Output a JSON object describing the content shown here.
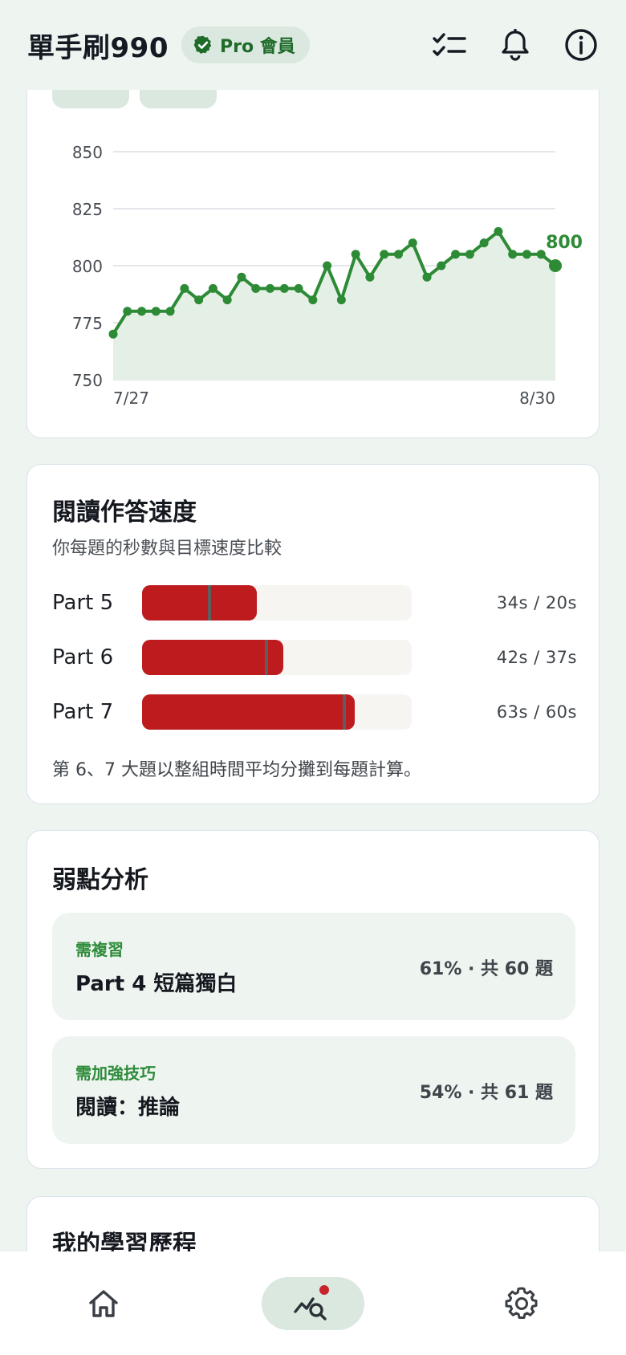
{
  "header": {
    "title": "單手刷990",
    "badge": "Pro 會員"
  },
  "chart_data": {
    "type": "area",
    "x_start_label": "7/27",
    "x_end_label": "8/30",
    "yticks": [
      850,
      825,
      800,
      775,
      750
    ],
    "ylim": [
      750,
      850
    ],
    "values": [
      770,
      780,
      780,
      780,
      780,
      790,
      785,
      790,
      785,
      795,
      790,
      790,
      790,
      790,
      785,
      800,
      785,
      805,
      795,
      805,
      805,
      810,
      795,
      800,
      805,
      805,
      810,
      815,
      805,
      805,
      805,
      800
    ],
    "last_value_label": "800",
    "line_color": "#2d8a35",
    "fill_color": "#e4efe6"
  },
  "speed": {
    "title": "閱讀作答速度",
    "subtitle": "你每題的秒數與目標速度比較",
    "rows": [
      {
        "label": "Part 5",
        "value_text": "34s / 20s",
        "actual": 34,
        "target": 20
      },
      {
        "label": "Part 6",
        "value_text": "42s / 37s",
        "actual": 42,
        "target": 37
      },
      {
        "label": "Part 7",
        "value_text": "63s / 60s",
        "actual": 63,
        "target": 60
      }
    ],
    "scale_max": 80,
    "note": "第 6、7 大題以整組時間平均分攤到每題計算。"
  },
  "weakness": {
    "title": "弱點分析",
    "items": [
      {
        "tag": "需複習",
        "name": "Part 4 短篇獨白",
        "stat": "61% · 共 60 題"
      },
      {
        "tag": "需加強技巧",
        "name": "閱讀：推論",
        "stat": "54% · 共 61 題"
      }
    ]
  },
  "journey": {
    "title": "我的學習歷程"
  },
  "nav": {
    "home": "home-icon",
    "stats": "stats-search-icon",
    "settings": "gear-icon"
  }
}
